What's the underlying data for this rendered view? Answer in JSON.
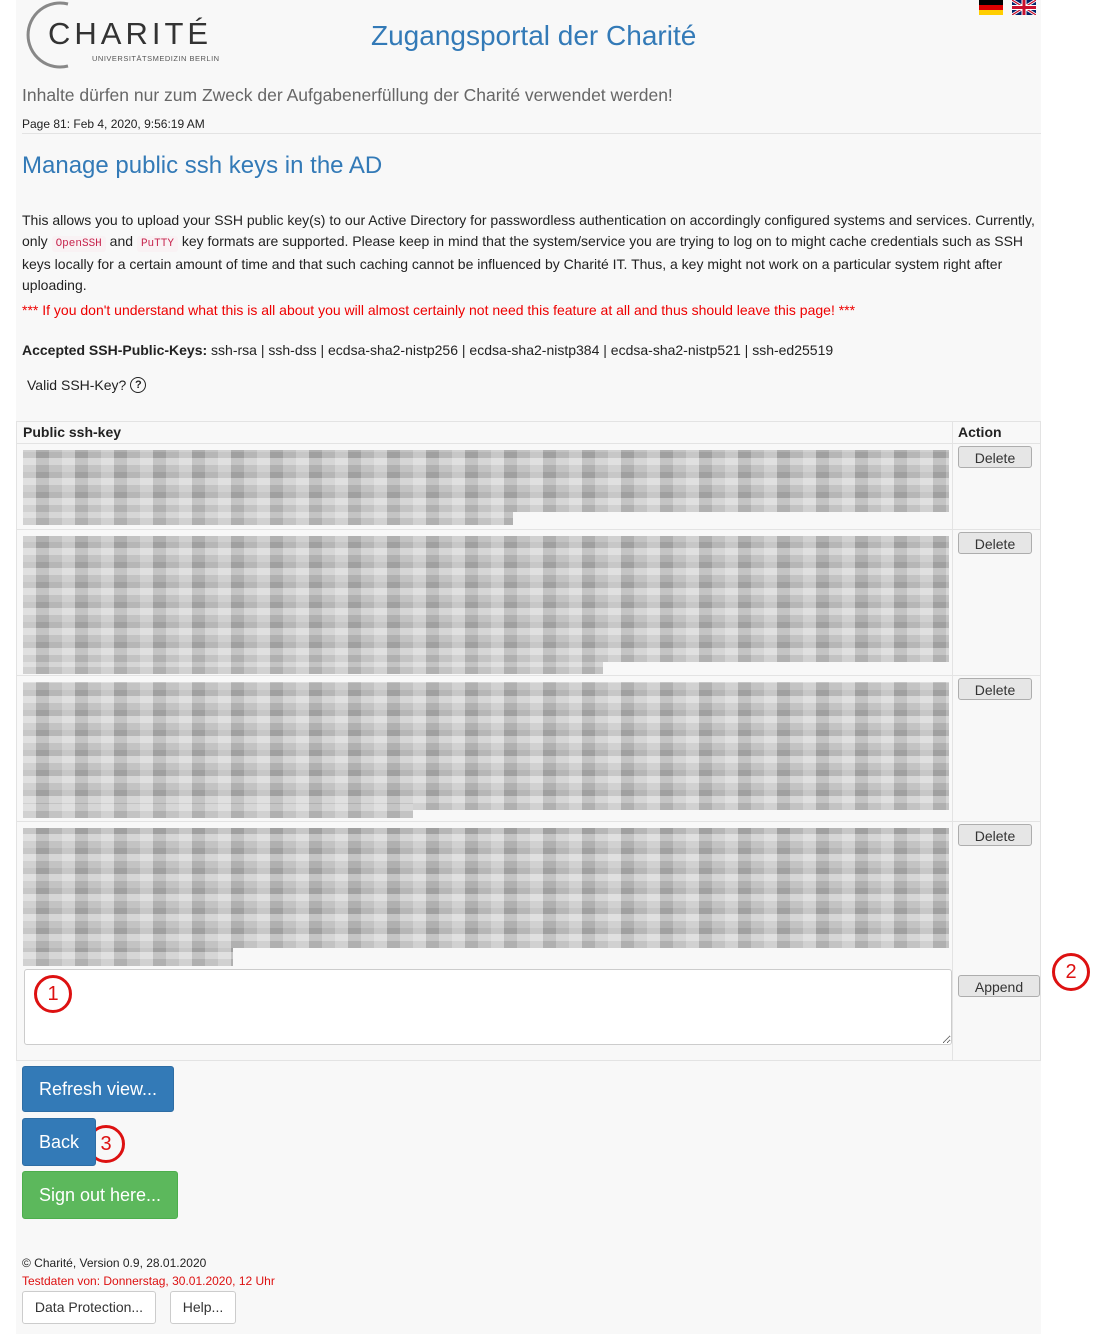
{
  "header": {
    "logo_word": "CHARITÉ",
    "logo_sub": "UNIVERSITÄTSMEDIZIN BERLIN",
    "portal_title": "Zugangsportal der Charité",
    "notice": "Inhalte dürfen nur zum Zweck der Aufgabenerfüllung der Charité verwendet werden!",
    "page_stamp": "Page 81: Feb 4, 2020, 9:56:19 AM",
    "languages": [
      "de-flag-icon",
      "uk-flag-icon"
    ]
  },
  "main": {
    "title": "Manage public ssh keys in the AD",
    "desc_part1": "This allows you to upload your SSH public key(s) to our Active Directory for passwordless authentication on accordingly configured systems and services. Currently, only ",
    "code_openssh": "OpenSSH",
    "desc_and": " and ",
    "code_putty": "PuTTY",
    "desc_part2": " key formats are supported. Please keep in mind that the system/service you are trying to log on to might cache credentials such as SSH keys locally for a certain amount of time and that such caching cannot be influenced by Charité IT. Thus, a key might not work on a particular system right after uploading.",
    "warning": "*** If you don't understand what this is all about you will almost certainly not need this feature at all and thus should leave this page! ***",
    "accepted_label": "Accepted SSH-Public-Keys:",
    "accepted_values": " ssh-rsa | ssh-dss | ecdsa-sha2-nistp256 | ecdsa-sha2-nistp384 | ecdsa-sha2-nistp521 | ssh-ed25519",
    "valid_label": "Valid SSH-Key?",
    "valid_help": "?"
  },
  "table": {
    "col_key": "Public ssh-key",
    "col_action": "Action",
    "delete_label": "Delete",
    "append_label": "Append",
    "input_placeholder": ""
  },
  "markers": [
    "1",
    "2",
    "3"
  ],
  "buttons": {
    "refresh": "Refresh view...",
    "back": "Back",
    "signout": "Sign out here..."
  },
  "footer": {
    "copyright": "© Charité, Version 0.9, 28.01.2020",
    "testdata": "Testdaten von: Donnerstag, 30.01.2020, 12 Uhr",
    "data_protection": "Data Protection...",
    "help": "Help..."
  },
  "colors": {
    "link_blue": "#337ab7",
    "warning_red": "#ee0000",
    "success_green": "#5cb85c",
    "marker_red": "#dd1111"
  }
}
